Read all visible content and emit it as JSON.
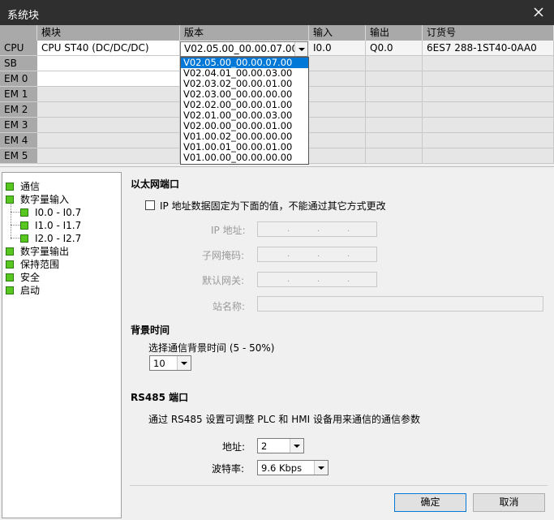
{
  "window": {
    "title": "系统块"
  },
  "grid": {
    "headers": [
      "模块",
      "版本",
      "输入",
      "输出",
      "订货号"
    ],
    "rows": [
      {
        "label": "CPU",
        "module": "CPU ST40 (DC/DC/DC)",
        "version": "V02.05.00_00.00.07.00",
        "input": "I0.0",
        "output": "Q0.0",
        "order": "6ES7 288-1ST40-0AA0"
      },
      {
        "label": "SB"
      },
      {
        "label": "EM 0"
      },
      {
        "label": "EM 1"
      },
      {
        "label": "EM 2"
      },
      {
        "label": "EM 3"
      },
      {
        "label": "EM 4"
      },
      {
        "label": "EM 5"
      }
    ],
    "version_options": [
      "V02.05.00_00.00.07.00",
      "V02.04.01_00.00.03.00",
      "V02.03.02_00.00.01.00",
      "V02.03.00_00.00.00.00",
      "V02.02.00_00.00.01.00",
      "V02.01.00_00.00.03.00",
      "V02.00.00_00.00.01.00",
      "V01.00.02_00.00.00.00",
      "V01.00.01_00.00.01.00",
      "V01.00.00_00.00.00.00"
    ],
    "version_selected_index": 0
  },
  "tree": {
    "items": [
      {
        "label": "通信"
      },
      {
        "label": "数字量输入"
      },
      {
        "label": "I0.0 - I0.7"
      },
      {
        "label": "I1.0 - I1.7"
      },
      {
        "label": "I2.0 - I2.7"
      },
      {
        "label": "数字量输出"
      },
      {
        "label": "保持范围"
      },
      {
        "label": "安全"
      },
      {
        "label": "启动"
      }
    ]
  },
  "ethernet": {
    "title": "以太网端口",
    "fixed_ip_label": "IP 地址数据固定为下面的值，不能通过其它方式更改",
    "fixed_ip_checked": false,
    "ip_label": "IP 地址:",
    "subnet_label": "子网掩码:",
    "gateway_label": "默认网关:",
    "station_label": "站名称:",
    "ip_dot": "."
  },
  "background": {
    "title": "背景时间",
    "label": "选择通信背景时间 (5 - 50%)",
    "value": "10"
  },
  "rs485": {
    "title": "RS485 端口",
    "desc": "通过 RS485 设置可调整 PLC 和 HMI 设备用来通信的通信参数",
    "address_label": "地址:",
    "address_value": "2",
    "baud_label": "波特率:",
    "baud_value": "9.6 Kbps"
  },
  "buttons": {
    "ok": "确定",
    "cancel": "取消"
  },
  "colors": {
    "titlebar": "#2f2f2f",
    "header": "#a9a9a9",
    "selection": "#0078d7",
    "tree_node": "#58c820"
  },
  "icons": [
    "close-icon",
    "dropdown-arrow-icon",
    "tree-node-icon"
  ]
}
